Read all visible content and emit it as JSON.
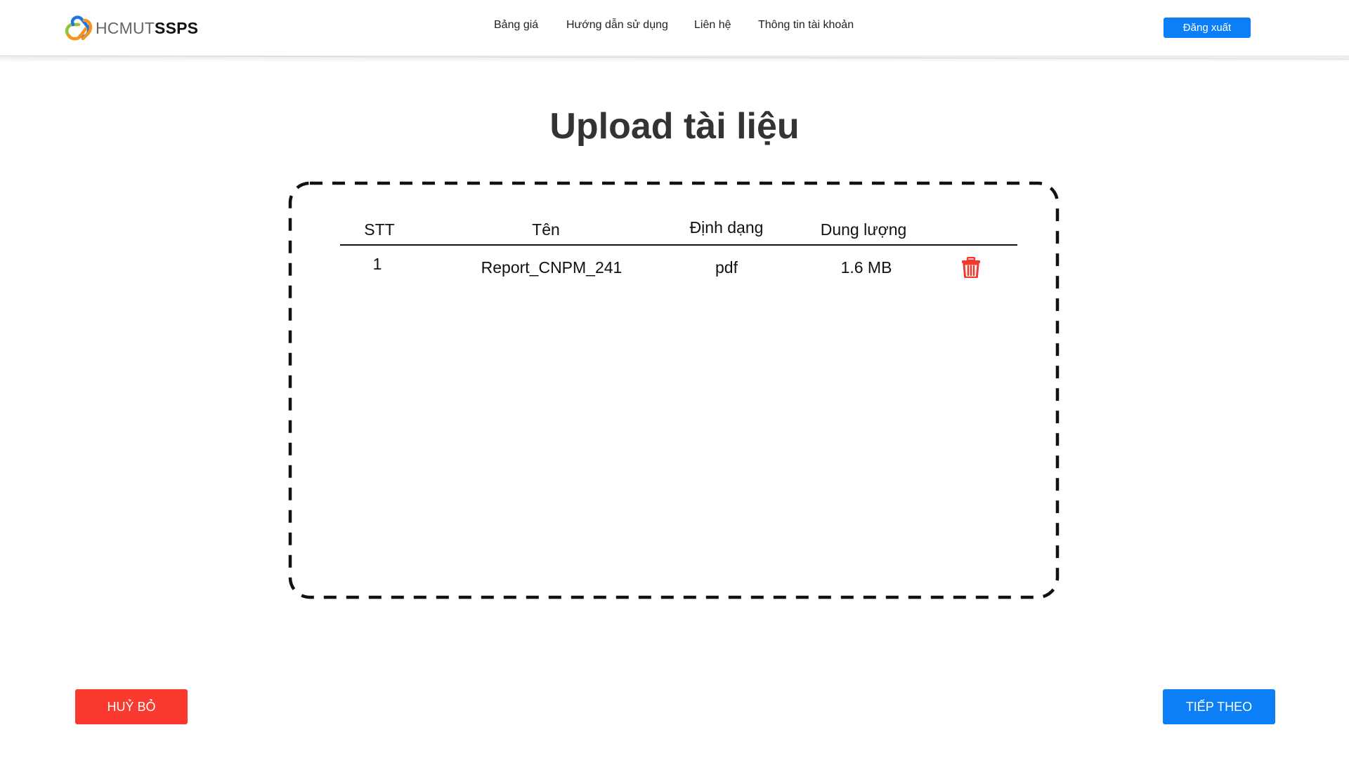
{
  "header": {
    "logo": {
      "text_light": "HCMUT",
      "text_bold": "SSPS",
      "icon": "linked-rings-logo-icon"
    },
    "nav": [
      {
        "label": "Bảng giá"
      },
      {
        "label": "Hướng dẫn sử dụng"
      },
      {
        "label": "Liên hệ"
      },
      {
        "label": "Thông tin tài khoản"
      }
    ],
    "logout_label": "Đăng xuất"
  },
  "main": {
    "title": "Upload tài liệu",
    "table": {
      "columns": [
        "STT",
        "Tên",
        "Định dạng",
        "Dung lượng"
      ],
      "rows": [
        {
          "stt": "1",
          "name": "Report_CNPM_241",
          "format": "pdf",
          "size": "1.6 MB",
          "action_icon": "trash-icon"
        }
      ]
    }
  },
  "footer": {
    "cancel_label": "HUỶ BỎ",
    "next_label": "TIẾP THEO"
  },
  "colors": {
    "primary": "#0d7ff6",
    "danger": "#fb3a2f",
    "logo_orange": "#f7931e",
    "logo_blue": "#1f74e6",
    "logo_green": "#8cc63f"
  }
}
